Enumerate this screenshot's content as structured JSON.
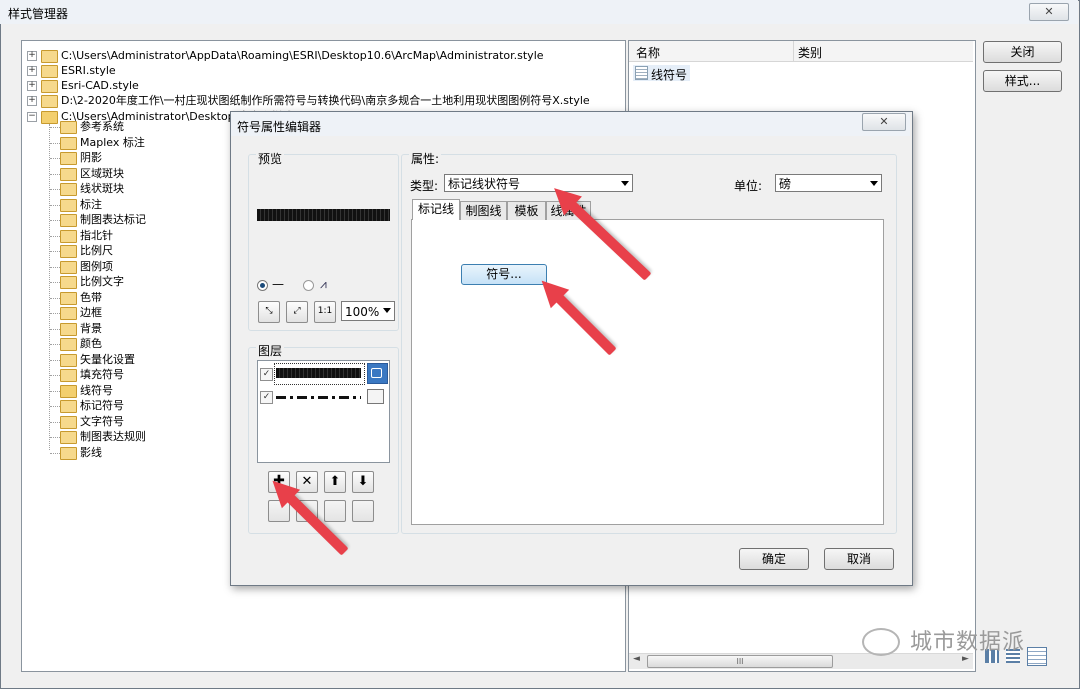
{
  "main_window": {
    "title": "样式管理器",
    "close_glyph": "✕",
    "buttons": {
      "close": "关闭",
      "styles": "样式..."
    },
    "tree": {
      "roots": [
        {
          "label": "C:\\Users\\Administrator\\AppData\\Roaming\\ESRI\\Desktop10.6\\ArcMap\\Administrator.style",
          "expander": "+"
        },
        {
          "label": "ESRI.style",
          "expander": "+"
        },
        {
          "label": "Esri-CAD.style",
          "expander": "+"
        },
        {
          "label": "D:\\2-2020年度工作\\一村庄现状图纸制作所需符号与转换代码\\南京多规合一土地利用现状图图例符号X.style",
          "expander": "+"
        },
        {
          "label": "C:\\Users\\Administrator\\Desktop\\自定义样式.style",
          "expander": "−"
        }
      ],
      "children": [
        "参考系统",
        "Maplex 标注",
        "阴影",
        "区域斑块",
        "线状斑块",
        "标注",
        "制图表达标记",
        "指北针",
        "比例尺",
        "图例项",
        "比例文字",
        "色带",
        "边框",
        "背景",
        "颜色",
        "矢量化设置",
        "填充符号",
        "线符号",
        "标记符号",
        "文字符号",
        "制图表达规则",
        "影线"
      ],
      "open_child": "线符号"
    },
    "list": {
      "columns": [
        "名称",
        "类别"
      ],
      "items": [
        {
          "name": "线符号"
        }
      ]
    },
    "scroll_glyphs": {
      "left": "◄",
      "right": "►",
      "thumb": "III"
    },
    "view_icons": [
      "large-icons-view",
      "list-view",
      "details-view"
    ]
  },
  "dialog": {
    "title": "符号属性编辑器",
    "close_glyph": "✕",
    "preview": {
      "label": "预览",
      "radio_solid_label": "—",
      "radio_zigzag_label": "⩘",
      "zoom_value": "100%",
      "zoom_buttons": [
        "zoom-in-icon",
        "zoom-out-icon",
        "actual-size-icon"
      ],
      "fit_label": "1:1"
    },
    "layers": {
      "label": "图层",
      "items": [
        {
          "checked": true,
          "style": "solid"
        },
        {
          "checked": true,
          "style": "dash-dot"
        }
      ],
      "buttons": [
        "add-layer",
        "remove-layer",
        "move-up",
        "move-down"
      ],
      "buttons2": [
        "copy-layer",
        "paste-layer",
        "undo",
        "tag"
      ],
      "glyphs": {
        "add": "✚",
        "remove": "✕",
        "up": "⬆",
        "down": "⬇",
        "check": "✓"
      }
    },
    "properties": {
      "label": "属性:",
      "type_label": "类型:",
      "type_value": "标记线状符号",
      "unit_label": "单位:",
      "unit_value": "磅",
      "tabs": [
        "标记线",
        "制图线",
        "模板",
        "线属性"
      ],
      "symbol_button": "符号..."
    },
    "ok": "确定",
    "cancel": "取消"
  },
  "watermark": {
    "text": "城市数据派"
  },
  "colors": {
    "accent": "#3c7fb1",
    "annotation_arrow": "#e8404a"
  }
}
